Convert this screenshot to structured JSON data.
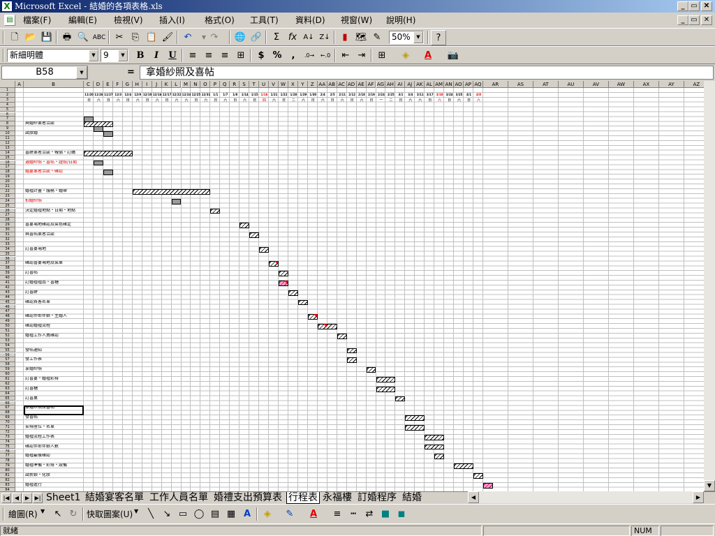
{
  "window": {
    "title": "Microsoft Excel - 結婚的各項表格.xls",
    "app_icon": "excel-icon",
    "controls": [
      "_",
      "🗗",
      "✕"
    ]
  },
  "menu": {
    "items": [
      "檔案(F)",
      "編輯(E)",
      "檢視(V)",
      "插入(I)",
      "格式(O)",
      "工具(T)",
      "資料(D)",
      "視窗(W)",
      "說明(H)"
    ]
  },
  "standard_toolbar": {
    "zoom": "50%"
  },
  "formatting_toolbar": {
    "font": "新細明體",
    "size": "9",
    "bold": "B",
    "italic": "I",
    "underline": "U",
    "currency": "$",
    "percent": "%",
    "comma": ","
  },
  "formula_bar": {
    "cell_ref": "B58",
    "eq": "=",
    "content": "拿婚紗照及喜帖"
  },
  "sheet": {
    "task_labels": [
      {
        "row": 8,
        "text": "與婚紗業者洽談",
        "color": "#000"
      },
      {
        "row": 10,
        "text": "試妝婚",
        "color": "#000"
      },
      {
        "row": 14,
        "text": "喜餅業者洽談・報價・訂購",
        "color": "#000"
      },
      {
        "row": 16,
        "text": "選婚紗照・喜帖・證照/日期",
        "color": "#e00000"
      },
      {
        "row": 18,
        "text": "婚宴業者洽談・確認",
        "color": "#e00000"
      },
      {
        "row": 22,
        "text": "婚禮計畫・服務・婚帶",
        "color": "#000"
      },
      {
        "row": 24,
        "text": "拍婚紗照",
        "color": "#e00000"
      },
      {
        "row": 26,
        "text": "決定婚禮地點・日期・地點",
        "color": "#000"
      },
      {
        "row": 29,
        "text": "喜宴場地確認及菜色確定",
        "color": "#000"
      },
      {
        "row": 31,
        "text": "與喜帖業者洽談",
        "color": "#000"
      },
      {
        "row": 34,
        "text": "訂喜宴場地",
        "color": "#000"
      },
      {
        "row": 37,
        "text": "確認喜宴場地及菜單",
        "color": "#000"
      },
      {
        "row": 39,
        "text": "訂喜帖",
        "color": "#000"
      },
      {
        "row": 41,
        "text": "訂婚禮禮品・喜糖",
        "color": "#000"
      },
      {
        "row": 43,
        "text": "訂喜餅",
        "color": "#000"
      },
      {
        "row": 45,
        "text": "確認賓客名單",
        "color": "#000"
      },
      {
        "row": 48,
        "text": "確認伴郎伴娘・主婚人",
        "color": "#000"
      },
      {
        "row": 50,
        "text": "確認婚禮流程",
        "color": "#000"
      },
      {
        "row": 52,
        "text": "婚禮工作人員確認",
        "color": "#000"
      },
      {
        "row": 55,
        "text": "發帖通知",
        "color": "#000"
      },
      {
        "row": 57,
        "text": "發工作表",
        "color": "#000"
      },
      {
        "row": 59,
        "text": "拿婚紗照",
        "color": "#000"
      },
      {
        "row": 61,
        "text": "訂喜宴・婚禮彩排",
        "color": "#000"
      },
      {
        "row": 63,
        "text": "訂喜糖",
        "color": "#000"
      },
      {
        "row": 65,
        "text": "訂喜桌",
        "color": "#000"
      },
      {
        "row": 67,
        "text": "拿婚紗照及喜帖",
        "color": "#000"
      },
      {
        "row": 69,
        "text": "發喜帖",
        "color": "#000"
      },
      {
        "row": 71,
        "text": "安排座位・名單",
        "color": "#000"
      },
      {
        "row": 73,
        "text": "婚禮流程工作表",
        "color": "#000"
      },
      {
        "row": 75,
        "text": "確認伴郎伴娘人數",
        "color": "#000"
      },
      {
        "row": 77,
        "text": "婚禮最後確認",
        "color": "#000"
      },
      {
        "row": 79,
        "text": "婚禮準備・彩排・設備",
        "color": "#000"
      },
      {
        "row": 81,
        "text": "試新娘・化妝",
        "color": "#000"
      },
      {
        "row": 83,
        "text": "婚禮進行",
        "color": "#000"
      }
    ],
    "dates": [
      "11/20",
      "11/26",
      "11/27",
      "12/3",
      "12/4",
      "12/9",
      "12/10",
      "12/16",
      "12/17",
      "12/22",
      "12/24",
      "12/25",
      "12/31",
      "1/1",
      "1/7",
      "1/8",
      "1/14",
      "1/15",
      "1/16",
      "1/21",
      "1/22",
      "1/28",
      "1/29",
      "1/30",
      "2/4",
      "2/5",
      "2/11",
      "2/12",
      "2/18",
      "2/19",
      "2/24",
      "2/25",
      "3/1",
      "3/4",
      "3/11",
      "3/17",
      "3/18",
      "3/24",
      "3/25",
      "4/1",
      "4/8"
    ],
    "weekdays": [
      "日",
      "六",
      "日",
      "六",
      "日",
      "六",
      "日",
      "六",
      "日",
      "六",
      "六",
      "日",
      "六",
      "日",
      "六",
      "日",
      "六",
      "日",
      "四",
      "六",
      "日",
      "二",
      "六",
      "日",
      "六",
      "日",
      "六",
      "日",
      "六",
      "日",
      "一",
      "二",
      "日",
      "六",
      "六",
      "日",
      "六",
      "日",
      "六",
      "日",
      "六"
    ],
    "col_letters": [
      "A",
      "B",
      "C",
      "D",
      "E",
      "F",
      "G",
      "H",
      "I",
      "J",
      "K",
      "L",
      "M",
      "N",
      "O",
      "P",
      "Q",
      "R",
      "S",
      "T",
      "U",
      "V",
      "W",
      "X",
      "Y",
      "Z",
      "AA",
      "AB",
      "AC",
      "AD",
      "AE",
      "AF",
      "AG",
      "AH",
      "AI",
      "AJ",
      "AK",
      "AL",
      "AM",
      "AN",
      "AO",
      "AP",
      "AQ",
      "AR",
      "AS",
      "AT",
      "AU",
      "AV",
      "AW",
      "AX",
      "AY",
      "AZ",
      "BA"
    ],
    "row_numbers": [
      "1",
      "2",
      "3",
      "4",
      "5",
      "6",
      "7",
      "8",
      "9",
      "10",
      "11",
      "12",
      "13",
      "14",
      "15",
      "16",
      "17",
      "18",
      "19",
      "20",
      "21",
      "22",
      "23",
      "24",
      "25",
      "26",
      "27",
      "28",
      "29",
      "30",
      "31",
      "32",
      "33",
      "34",
      "35",
      "36",
      "37",
      "38",
      "39",
      "40",
      "41",
      "42",
      "43",
      "44",
      "45",
      "46",
      "47",
      "48",
      "49",
      "50",
      "51",
      "52",
      "53",
      "54",
      "55",
      "56",
      "57",
      "58",
      "59",
      "60",
      "61",
      "62",
      "63",
      "64",
      "65",
      "66",
      "67",
      "68",
      "69",
      "70",
      "71",
      "72",
      "73",
      "74",
      "75",
      "76",
      "77",
      "78",
      "79",
      "80",
      "81",
      "82",
      "83",
      "84"
    ]
  },
  "sheet_tabs": {
    "tabs": [
      "Sheet1",
      "結婚宴客名單",
      "工作人員名單",
      "婚禮支出預算表",
      "行程表",
      "永福樓",
      "訂婚程序",
      "結婚"
    ],
    "active": "行程表"
  },
  "drawing_toolbar": {
    "draw": "繪圖(R)",
    "autoshapes": "快取圖案(U)"
  },
  "status": {
    "text": "就緒",
    "num": "NUM"
  }
}
